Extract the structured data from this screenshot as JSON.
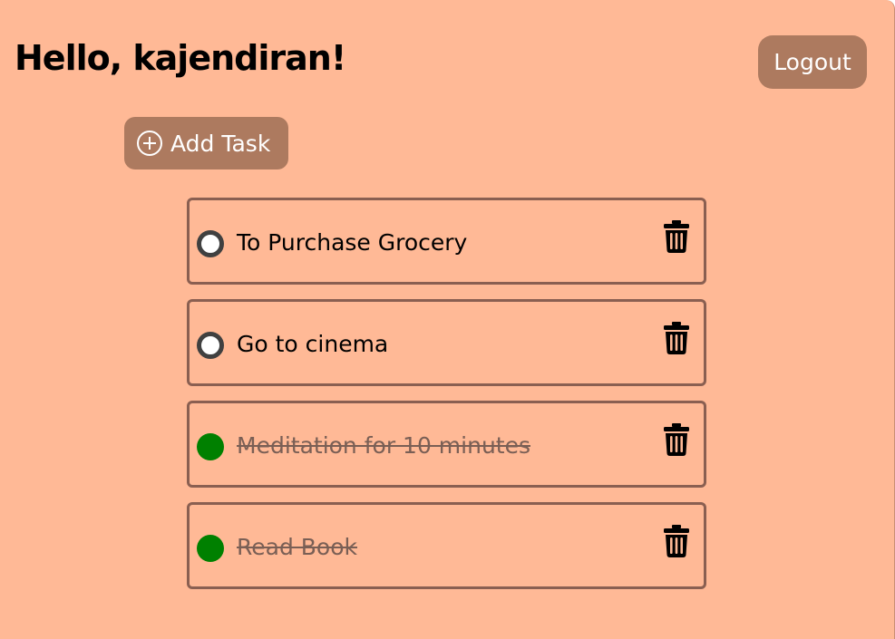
{
  "header": {
    "greeting": "Hello, kajendiran!",
    "logout_label": "Logout"
  },
  "toolbar": {
    "add_task_label": "Add Task",
    "add_task_icon": "plus-circle-icon"
  },
  "colors": {
    "background": "#ffb996",
    "button": "#ad7a5f",
    "completed": "#008000",
    "task_border": "#8a5f51"
  },
  "tasks": [
    {
      "text": "To Purchase Grocery",
      "completed": false,
      "delete_icon": "trash-icon"
    },
    {
      "text": "Go to cinema",
      "completed": false,
      "delete_icon": "trash-icon"
    },
    {
      "text": "Meditation for 10 minutes",
      "completed": true,
      "delete_icon": "trash-icon"
    },
    {
      "text": "Read Book",
      "completed": true,
      "delete_icon": "trash-icon"
    }
  ]
}
